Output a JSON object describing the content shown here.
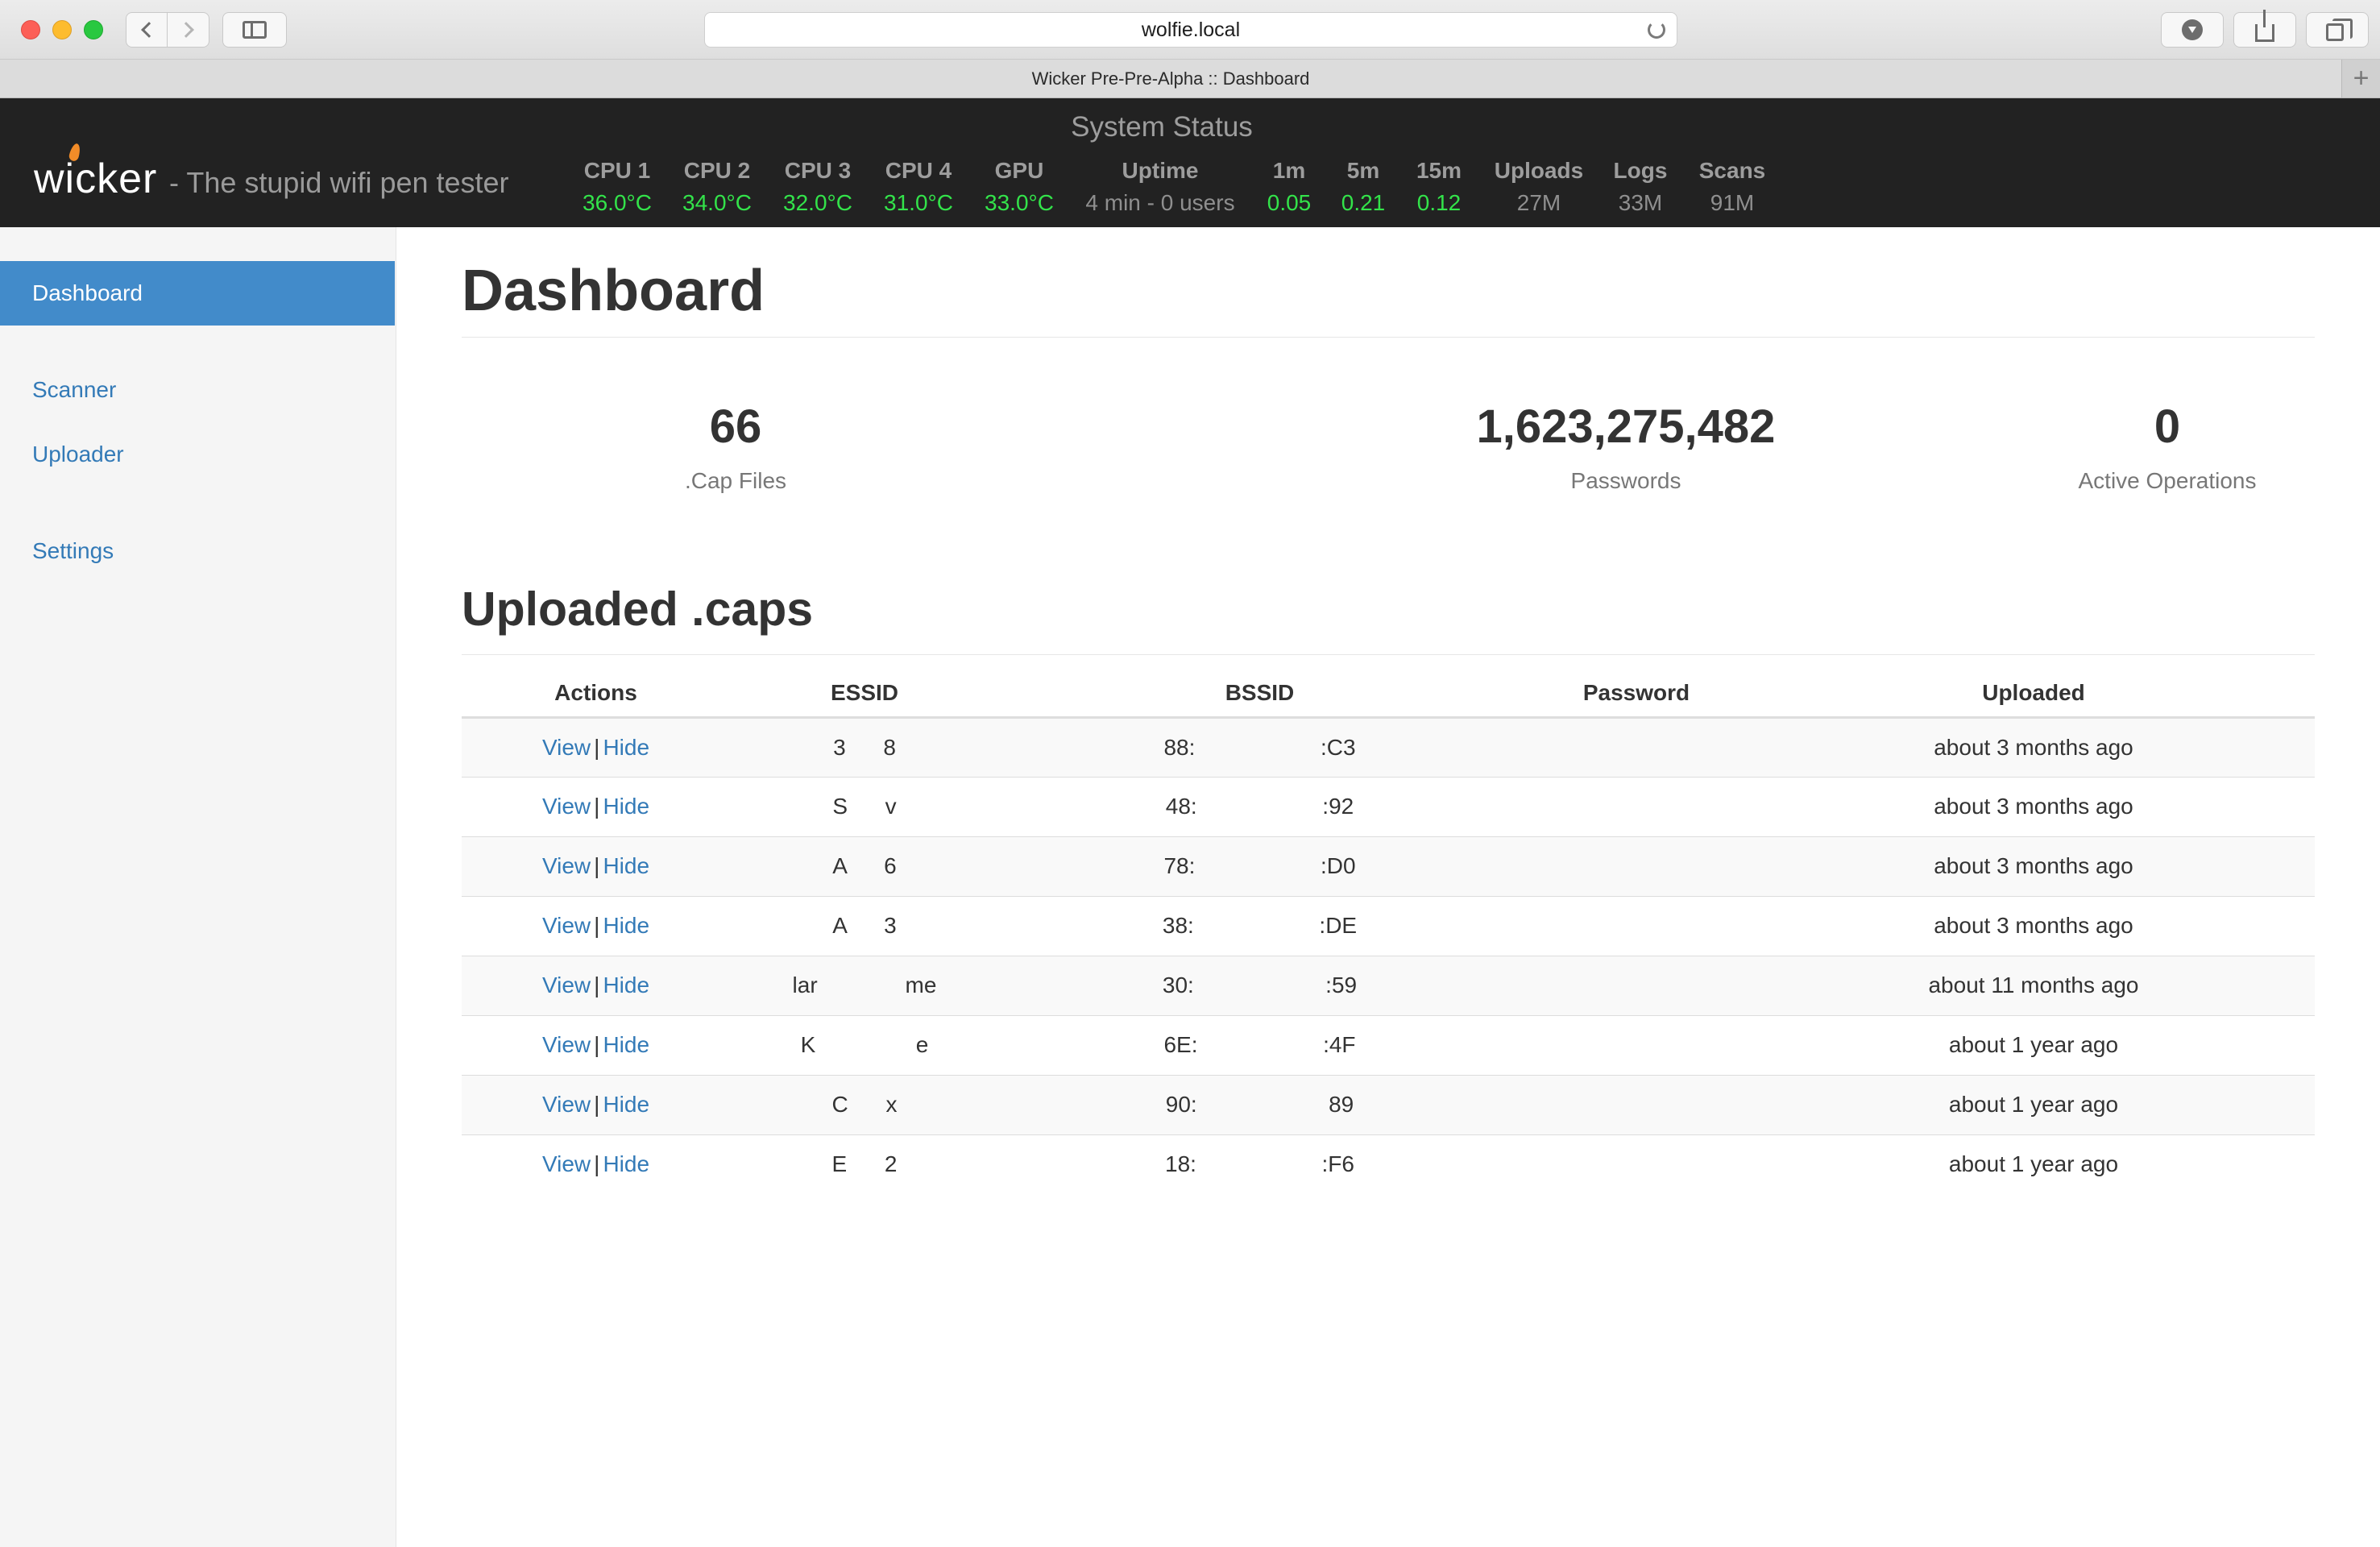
{
  "browser": {
    "url": "wolfie.local",
    "tab_title": "Wicker Pre-Pre-Alpha :: Dashboard",
    "new_tab_label": "+"
  },
  "header": {
    "logo": "wicker",
    "tagline": "- The stupid wifi pen tester",
    "status_title": "System Status",
    "stats": [
      {
        "label": "CPU 1",
        "value": "36.0°C"
      },
      {
        "label": "CPU 2",
        "value": "34.0°C"
      },
      {
        "label": "CPU 3",
        "value": "32.0°C"
      },
      {
        "label": "CPU 4",
        "value": "31.0°C"
      },
      {
        "label": "GPU",
        "value": "33.0°C"
      },
      {
        "label": "Uptime",
        "value": "4 min - 0 users"
      },
      {
        "label": "1m",
        "value": "0.05"
      },
      {
        "label": "5m",
        "value": "0.21"
      },
      {
        "label": "15m",
        "value": "0.12"
      },
      {
        "label": "Uploads",
        "value": "27M"
      },
      {
        "label": "Logs",
        "value": "33M"
      },
      {
        "label": "Scans",
        "value": "91M"
      }
    ]
  },
  "sidebar": {
    "items": [
      {
        "label": "Dashboard"
      },
      {
        "label": "Scanner"
      },
      {
        "label": "Uploader"
      },
      {
        "label": "Settings"
      }
    ]
  },
  "main": {
    "title": "Dashboard",
    "kpis": [
      {
        "value": "66",
        "label": ".Cap Files"
      },
      {
        "value": "1,623,275,482",
        "label": "Passwords"
      },
      {
        "value": "0",
        "label": "Active Operations"
      }
    ],
    "section_title": "Uploaded .caps",
    "table": {
      "headers": [
        "Actions",
        "ESSID",
        "BSSID",
        "Password",
        "Uploaded"
      ],
      "view_label": "View",
      "separator": "|",
      "hide_label": "Hide",
      "rows": [
        {
          "essid": "3      8",
          "bssid": "88:                    :C3",
          "password": "",
          "uploaded": "about 3 months ago"
        },
        {
          "essid": "S      v",
          "bssid": "48:                    :92",
          "password": "",
          "uploaded": "about 3 months ago"
        },
        {
          "essid": "A      6",
          "bssid": "78:                    :D0",
          "password": "",
          "uploaded": "about 3 months ago"
        },
        {
          "essid": "A      3",
          "bssid": "38:                    :DE",
          "password": "",
          "uploaded": "about 3 months ago"
        },
        {
          "essid": "lar              me",
          "bssid": "30:                     :59",
          "password": "",
          "uploaded": "about 11 months ago"
        },
        {
          "essid": "K                e",
          "bssid": "6E:                    :4F",
          "password": "",
          "uploaded": "about 1 year ago"
        },
        {
          "essid": "C      x",
          "bssid": "90:                     89",
          "password": "",
          "uploaded": "about 1 year ago"
        },
        {
          "essid": "E      2",
          "bssid": "18:                    :F6",
          "password": "",
          "uploaded": "about 1 year ago"
        }
      ]
    }
  },
  "colors": {
    "header_bg": "#222222",
    "temp_green": "#33e34a",
    "link_blue": "#337ab7",
    "active_nav": "#428bca"
  },
  "icons": [
    "back-chevron-icon",
    "forward-chevron-icon",
    "sidebar-icon",
    "reload-icon",
    "download-icon",
    "share-icon",
    "tabs-icon",
    "flame-icon"
  ]
}
